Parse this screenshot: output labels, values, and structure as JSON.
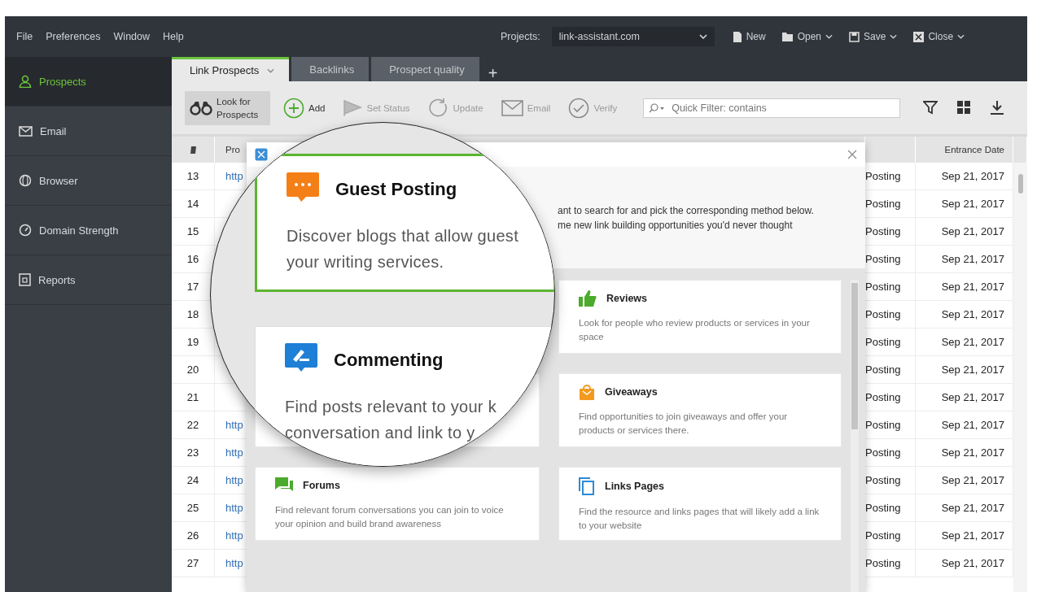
{
  "menu": [
    "File",
    "Preferences",
    "Window",
    "Help"
  ],
  "project": {
    "label": "Projects:",
    "value": "link-assistant.com"
  },
  "file_actions": [
    {
      "label": "New",
      "dropdown": false
    },
    {
      "label": "Open",
      "dropdown": true
    },
    {
      "label": "Save",
      "dropdown": true
    },
    {
      "label": "Close",
      "dropdown": true
    }
  ],
  "sidebar": {
    "items": [
      {
        "label": "Prospects",
        "selected": true
      },
      {
        "label": "Email",
        "selected": false
      },
      {
        "label": "Browser",
        "selected": false
      },
      {
        "label": "Domain Strength",
        "selected": false
      },
      {
        "label": "Reports",
        "selected": false
      }
    ]
  },
  "tabs": [
    {
      "label": "Link Prospects",
      "selected": true,
      "dropdown": true
    },
    {
      "label": "Backlinks",
      "selected": false,
      "dropdown": false
    },
    {
      "label": "Prospect quality",
      "selected": false,
      "dropdown": false
    }
  ],
  "add_tab": "+",
  "toolbar": {
    "buttons": [
      {
        "label": "Look for Prospects",
        "disabled": false,
        "pressed": true
      },
      {
        "label": "Add",
        "disabled": false,
        "pressed": false
      },
      {
        "label": "Set Status",
        "disabled": true,
        "pressed": false
      },
      {
        "label": "Update",
        "disabled": true,
        "pressed": false
      },
      {
        "label": "Email",
        "disabled": true,
        "pressed": false
      },
      {
        "label": "Verify",
        "disabled": true,
        "pressed": false
      }
    ],
    "search": {
      "placeholder": "Quick Filter: contains"
    }
  },
  "table": {
    "columns": {
      "prospect": "Pro",
      "date": "Entrance Date"
    },
    "rows": [
      {
        "number": "13",
        "prospect": "http",
        "status": "Posting",
        "date": "Sep 21, 2017"
      },
      {
        "number": "14",
        "status": "Posting",
        "date": "Sep 21, 2017"
      },
      {
        "number": "15",
        "status": "Posting",
        "date": "Sep 21, 2017"
      },
      {
        "number": "16",
        "status": "Posting",
        "date": "Sep 21, 2017"
      },
      {
        "number": "17",
        "status": "Posting",
        "date": "Sep 21, 2017"
      },
      {
        "number": "18",
        "status": "Posting",
        "date": "Sep 21, 2017"
      },
      {
        "number": "19",
        "status": "Posting",
        "date": "Sep 21, 2017"
      },
      {
        "number": "20",
        "status": "Posting",
        "date": "Sep 21, 2017"
      },
      {
        "number": "21",
        "status": "Posting",
        "date": "Sep 21, 2017"
      },
      {
        "number": "22",
        "prospect": "http",
        "status": "Posting",
        "date": "Sep 21, 2017"
      },
      {
        "number": "23",
        "prospect": "http",
        "status": "Posting",
        "date": "Sep 21, 2017"
      },
      {
        "number": "24",
        "prospect": "http",
        "status": "Posting",
        "date": "Sep 21, 2017"
      },
      {
        "number": "25",
        "prospect": "http",
        "status": "Posting",
        "date": "Sep 21, 2017"
      },
      {
        "number": "26",
        "prospect": "http",
        "status": "Posting",
        "date": "Sep 21, 2017"
      },
      {
        "number": "27",
        "prospect": "http",
        "status": "Posting",
        "date": "Sep 21, 2017"
      }
    ]
  },
  "dialog": {
    "description": [
      "ant to search for and pick the corresponding method below.",
      "me new link building opportunities you'd never thought"
    ],
    "left_column": [
      {
        "title": "Forums",
        "description": "Find relevant forum conversations you can join to voice your opinion and build brand awareness"
      }
    ],
    "right_column": [
      {
        "title": "Reviews",
        "description": "Look for people who review products or services in your space"
      },
      {
        "title": "Giveaways",
        "description": "Find opportunities to join giveaways and offer your products or services there."
      },
      {
        "title": "Links Pages",
        "description": "Find the resource and links pages that will likely add a link to your website"
      }
    ]
  },
  "magnifier": {
    "methods": [
      {
        "title": "Guest Posting",
        "lines": [
          "Discover blogs that allow guest",
          "your writing services."
        ],
        "selected": true
      },
      {
        "title": "Commenting",
        "lines": [
          "Find posts relevant to your k",
          "conversation and link to y"
        ],
        "selected": false
      }
    ]
  }
}
